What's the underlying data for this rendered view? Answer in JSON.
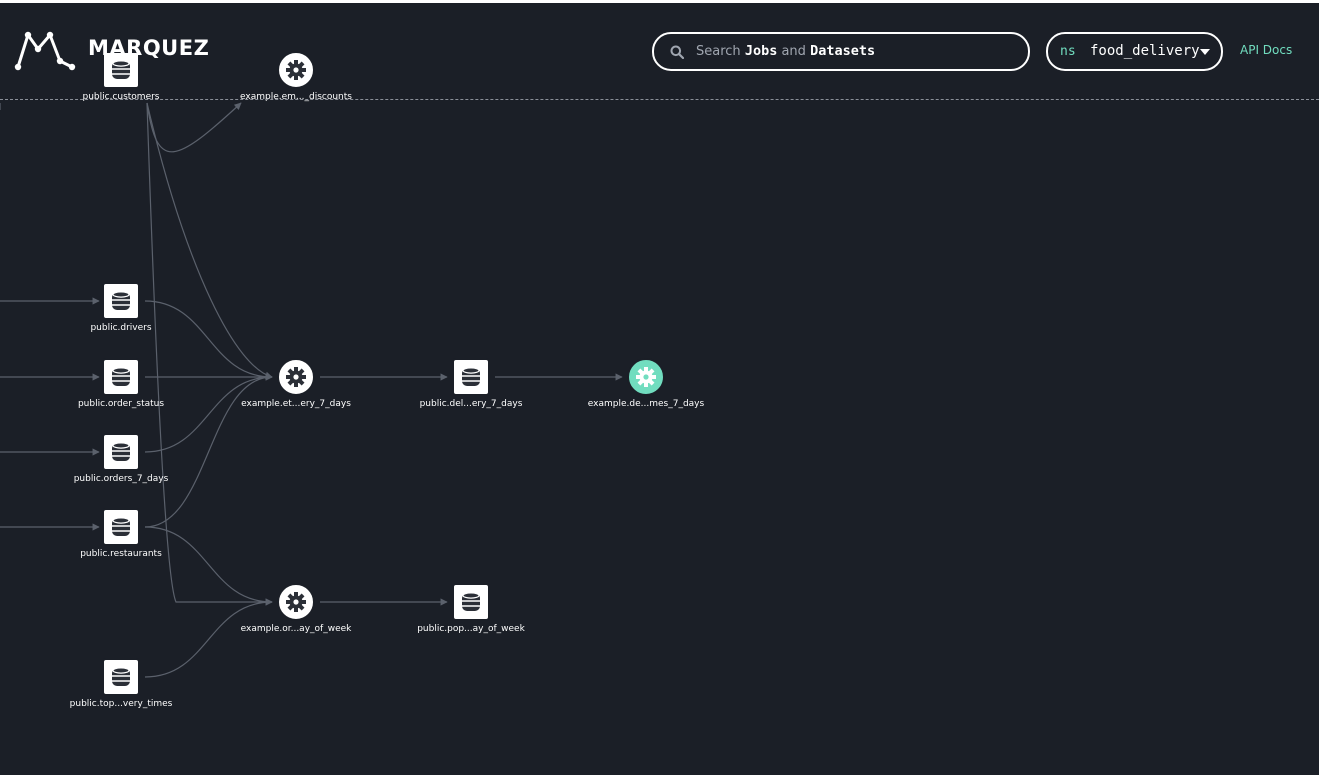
{
  "header": {
    "brand": "MARQUEZ",
    "search": {
      "prefix": "Search",
      "jobs": "Jobs",
      "and": "and",
      "datasets": "Datasets"
    },
    "namespace": {
      "prefix": "ns",
      "value": "food_delivery"
    },
    "api_docs": "API Docs"
  },
  "colors": {
    "background": "#1b1f27",
    "accent": "#71ddbf",
    "edge": "#5b616c",
    "node": "#ffffff"
  },
  "graph": {
    "nodes": [
      {
        "id": "public_customers",
        "type": "dataset",
        "label": "public.customers"
      },
      {
        "id": "example_discounts",
        "type": "job",
        "label": "example.em..._discounts"
      },
      {
        "id": "public_drivers",
        "type": "dataset",
        "label": "public.drivers"
      },
      {
        "id": "public_order_status",
        "type": "dataset",
        "label": "public.order_status"
      },
      {
        "id": "public_orders_7_days",
        "type": "dataset",
        "label": "public.orders_7_days"
      },
      {
        "id": "public_restaurants",
        "type": "dataset",
        "label": "public.restaurants"
      },
      {
        "id": "public_top_times",
        "type": "dataset",
        "label": "public.top...very_times"
      },
      {
        "id": "example_et_7_days",
        "type": "job",
        "label": "example.et...ery_7_days"
      },
      {
        "id": "example_or_week",
        "type": "job",
        "label": "example.or...ay_of_week"
      },
      {
        "id": "public_del_7_days",
        "type": "dataset",
        "label": "public.del...ery_7_days"
      },
      {
        "id": "public_pop_week",
        "type": "dataset",
        "label": "public.pop...ay_of_week"
      },
      {
        "id": "example_de_7_days",
        "type": "job",
        "label": "example.de...mes_7_days",
        "selected": true
      }
    ],
    "edges": [
      [
        "public_customers",
        "example_discounts"
      ],
      [
        "public_customers",
        "example_et_7_days"
      ],
      [
        "public_customers",
        "example_or_week"
      ],
      [
        "public_drivers",
        "example_et_7_days"
      ],
      [
        "public_order_status",
        "example_et_7_days"
      ],
      [
        "public_orders_7_days",
        "example_et_7_days"
      ],
      [
        "public_restaurants",
        "example_et_7_days"
      ],
      [
        "public_restaurants",
        "example_or_week"
      ],
      [
        "public_top_times",
        "example_or_week"
      ],
      [
        "example_et_7_days",
        "public_del_7_days"
      ],
      [
        "public_del_7_days",
        "example_de_7_days"
      ],
      [
        "example_or_week",
        "public_pop_week"
      ]
    ]
  }
}
